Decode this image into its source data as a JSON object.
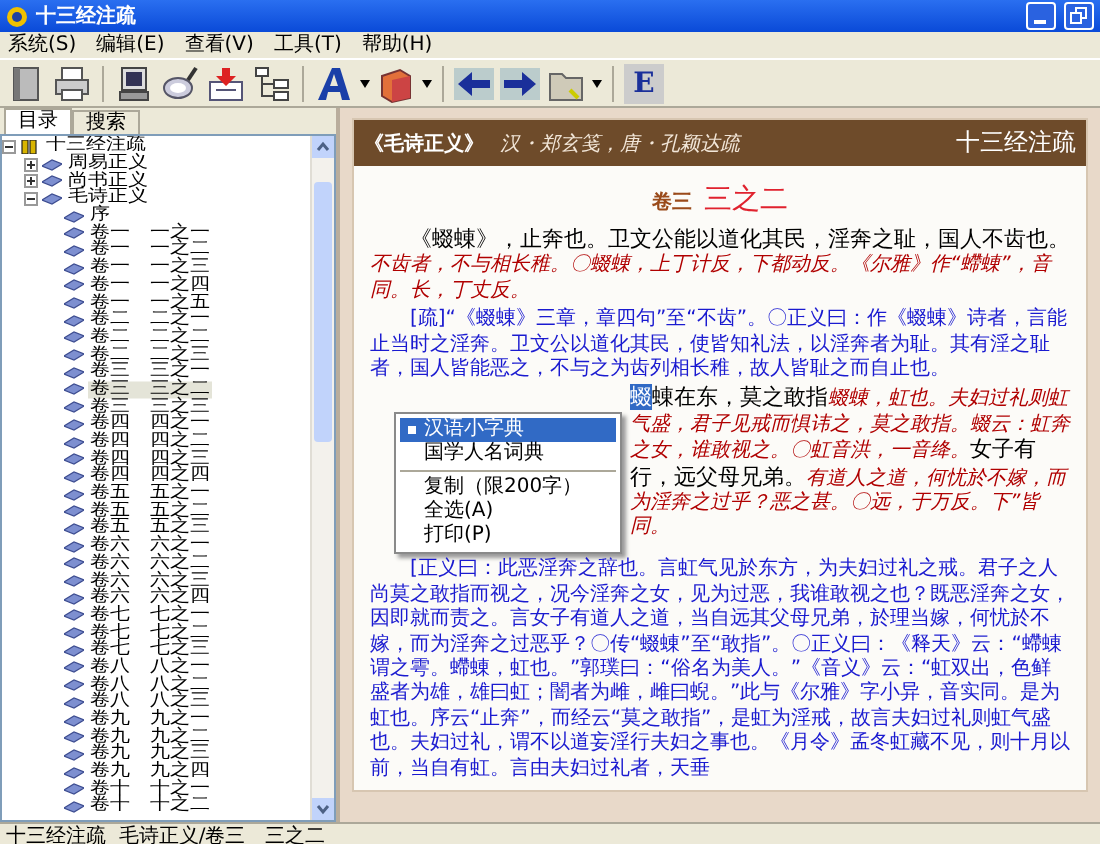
{
  "window": {
    "title": "十三经注疏"
  },
  "menu": [
    "系统(S)",
    "编辑(E)",
    "查看(V)",
    "工具(T)",
    "帮助(H)"
  ],
  "toolbar": {
    "letter_button": "E"
  },
  "tabs": [
    {
      "label": "目录",
      "selected": true
    },
    {
      "label": "搜索",
      "selected": false
    }
  ],
  "tree": [
    {
      "label": "十三经注疏",
      "expanded": true,
      "selected": false,
      "children": [
        {
          "label": "周易正义",
          "expanded": false,
          "selected": false
        },
        {
          "label": "尚书正义",
          "expanded": false,
          "selected": false
        },
        {
          "label": "毛诗正义",
          "expanded": true,
          "selected": false,
          "children": [
            {
              "label": "序",
              "selected": false
            },
            {
              "label": "卷一　一之一",
              "selected": false
            },
            {
              "label": "卷一　一之二",
              "selected": false
            },
            {
              "label": "卷一　一之三",
              "selected": false
            },
            {
              "label": "卷一　一之四",
              "selected": false
            },
            {
              "label": "卷一　一之五",
              "selected": false
            },
            {
              "label": "卷二　二之一",
              "selected": false
            },
            {
              "label": "卷二　二之二",
              "selected": false
            },
            {
              "label": "卷二　二之三",
              "selected": false
            },
            {
              "label": "卷三　三之一",
              "selected": false
            },
            {
              "label": "卷三　三之二",
              "selected": true
            },
            {
              "label": "卷三　三之三",
              "selected": false
            },
            {
              "label": "卷四　四之一",
              "selected": false
            },
            {
              "label": "卷四　四之二",
              "selected": false
            },
            {
              "label": "卷四　四之三",
              "selected": false
            },
            {
              "label": "卷四　四之四",
              "selected": false
            },
            {
              "label": "卷五　五之一",
              "selected": false
            },
            {
              "label": "卷五　五之二",
              "selected": false
            },
            {
              "label": "卷五　五之三",
              "selected": false
            },
            {
              "label": "卷六　六之一",
              "selected": false
            },
            {
              "label": "卷六　六之二",
              "selected": false
            },
            {
              "label": "卷六　六之三",
              "selected": false
            },
            {
              "label": "卷六　六之四",
              "selected": false
            },
            {
              "label": "卷七　七之一",
              "selected": false
            },
            {
              "label": "卷七　七之二",
              "selected": false
            },
            {
              "label": "卷七　七之三",
              "selected": false
            },
            {
              "label": "卷八　八之一",
              "selected": false
            },
            {
              "label": "卷八　八之二",
              "selected": false
            },
            {
              "label": "卷八　八之三",
              "selected": false
            },
            {
              "label": "卷九　九之一",
              "selected": false
            },
            {
              "label": "卷九　九之二",
              "selected": false
            },
            {
              "label": "卷九　九之三",
              "selected": false
            },
            {
              "label": "卷九　九之四",
              "selected": false
            },
            {
              "label": "卷十　十之一",
              "selected": false
            },
            {
              "label": "卷十　十之二",
              "selected": false
            }
          ]
        }
      ]
    }
  ],
  "document": {
    "header": {
      "title": "《毛诗正义》",
      "authors": "汉・郑玄笺，唐・孔颖达疏",
      "collection": "十三经注疏"
    },
    "heading": {
      "volume": "卷三",
      "section": "三之二"
    },
    "paragraphs": [
      {
        "segments": [
          {
            "kind": "main",
            "text": "《蝃蝀》，止奔也。卫文公能以道化其民，淫奔之耻，国人不齿也。"
          },
          {
            "kind": "note",
            "text": "不齿者，不与相长稚。〇蝃蝀，上丁计反，下都动反。《尔雅》作“螮蝀”，音同。长，丁丈反。"
          }
        ]
      },
      {
        "segments": [
          {
            "kind": "shu",
            "text": "[疏]“《蝃蝀》三章，章四句”至“不齿”。〇正义曰：作《蝃蝀》诗者，言能止当时之淫奔。卫文公以道化其民，使皆知礼法，以淫奔者为耻。其有淫之耻者，国人皆能恶之，不与之为齿列相长稚，故人皆耻之而自止也。"
          }
        ]
      },
      {
        "menu_beside": true,
        "segments": [
          {
            "kind": "selection",
            "text": "蝃"
          },
          {
            "kind": "main",
            "text": "蝀在东，莫之敢指"
          },
          {
            "kind": "note",
            "text": "蝃蝀，虹也。夫妇过礼则虹气盛，君子见戒而惧讳之，莫之敢指。蝃"
          },
          {
            "kind": "note",
            "text": "云：虹"
          },
          {
            "kind": "note",
            "text": "奔之女，谁敢视之。〇虹音洪，一音绛。"
          },
          {
            "kind": "main",
            "text": "女子有行，远父母"
          },
          {
            "kind": "main",
            "text": "兄弟。"
          },
          {
            "kind": "note",
            "text": "有道人之道，何忧於不嫁，而为淫奔之过乎？恶之甚。〇远，于万"
          },
          {
            "kind": "note",
            "text": "反。下"
          },
          {
            "kind": "note",
            "text": "”皆同。"
          }
        ]
      },
      {
        "segments": [
          {
            "kind": "shu",
            "text": "["
          },
          {
            "kind": "shu",
            "text": "正义曰：此恶淫奔之辞也。言虹气见於东方，为夫妇过礼之戒。君子之人尚莫之敢指而视之，况今淫奔之女，见为过恶，我谁敢视之也？既恶淫奔之女，因即就而责之。言女子有道人之道，当自远其父母兄弟，於理当嫁，何忧於不嫁，而为淫奔之过恶乎？〇传“蝃蝀”至“敢指”。〇正义曰：《释天》云：“螮蝀谓之雩。螮蝀，虹也。”郭璞曰：“俗名为美人。”《音义》云：“虹双出，色鲜盛者为雄，雄曰虹；闇者为雌，雌曰蜺。”此与《尔雅》字小异，音实同。是为虹也。序云“止奔”，而经云“莫之敢指”，是虹为淫戒，故言夫妇过礼则虹气盛也。夫妇过礼，谓不以道妄淫行夫妇之事也。《月令》孟冬虹藏不见，则十月以前，当自有虹。言由夫妇过礼者，天垂"
          }
        ]
      }
    ],
    "context_menu": [
      {
        "kind": "command",
        "label": "汉语小字典",
        "selected": true,
        "checked": true
      },
      {
        "kind": "command",
        "label": "国学人名词典",
        "selected": false,
        "checked": false
      },
      {
        "kind": "separator"
      },
      {
        "kind": "command",
        "label": "复制（限200字）",
        "selected": false,
        "checked": false
      },
      {
        "kind": "command",
        "label": "全选(A)",
        "selected": false,
        "checked": false
      },
      {
        "kind": "command",
        "label": "打印(P)",
        "selected": false,
        "checked": false
      }
    ]
  },
  "status_bar": "十三经注疏  毛诗正义/卷三　三之二"
}
